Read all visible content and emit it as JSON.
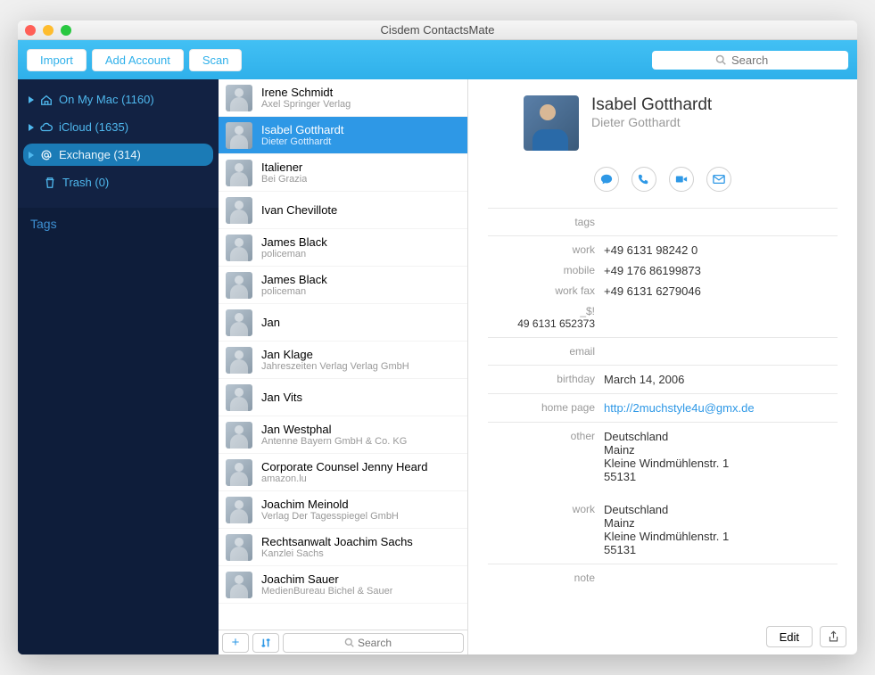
{
  "window": {
    "title": "Cisdem ContactsMate"
  },
  "toolbar": {
    "import": "Import",
    "add_account": "Add Account",
    "scan": "Scan",
    "search_placeholder": "Search"
  },
  "sidebar": {
    "accounts": [
      {
        "icon": "home",
        "label": "On My Mac (1160)",
        "selected": false
      },
      {
        "icon": "cloud",
        "label": "iCloud (1635)",
        "selected": false
      },
      {
        "icon": "at",
        "label": "Exchange (314)",
        "selected": true
      }
    ],
    "trash": "Trash (0)",
    "tags_label": "Tags"
  },
  "contacts": [
    {
      "name": "Irene Schmidt",
      "sub": "Axel Springer Verlag",
      "selected": false
    },
    {
      "name": "Isabel Gotthardt",
      "sub": "Dieter Gotthardt",
      "selected": true
    },
    {
      "name": "Italiener",
      "sub": "Bei Grazia",
      "selected": false
    },
    {
      "name": "Ivan Chevillote",
      "sub": "",
      "selected": false
    },
    {
      "name": "James Black",
      "sub": "policeman",
      "selected": false
    },
    {
      "name": "James Black",
      "sub": "policeman",
      "selected": false
    },
    {
      "name": "Jan",
      "sub": "",
      "selected": false
    },
    {
      "name": "Jan Klage",
      "sub": "Jahreszeiten Verlag Verlag GmbH",
      "selected": false
    },
    {
      "name": "Jan Vits",
      "sub": "",
      "selected": false
    },
    {
      "name": "Jan Westphal",
      "sub": "Antenne Bayern GmbH & Co. KG",
      "selected": false
    },
    {
      "name": "Corporate Counsel Jenny Heard",
      "sub": "amazon.lu",
      "selected": false
    },
    {
      "name": "Joachim Meinold",
      "sub": "Verlag Der Tagesspiegel GmbH",
      "selected": false
    },
    {
      "name": "Rechtsanwalt Joachim Sachs",
      "sub": "Kanzlei Sachs",
      "selected": false
    },
    {
      "name": "Joachim Sauer",
      "sub": "MedienBureau Bichel & Sauer",
      "selected": false
    }
  ],
  "bottom_search_placeholder": "Search",
  "detail": {
    "name": "Isabel Gotthardt",
    "subname": "Dieter Gotthardt",
    "section_tags": "tags",
    "phones": [
      {
        "label": "work",
        "value": "+49 6131 98242 0"
      },
      {
        "label": "mobile",
        "value": "+49 176 86199873"
      },
      {
        "label": "work fax",
        "value": "+49 6131 6279046"
      },
      {
        "label": "_$!<EX-CarPhone…",
        "value": "49 6131 652373"
      }
    ],
    "section_email": "email",
    "birthday_label": "birthday",
    "birthday": "March 14, 2006",
    "homepage_label": "home page",
    "homepage": "http://2muchstyle4u@gmx.de",
    "addresses": [
      {
        "label": "other",
        "lines": [
          "Deutschland",
          "Mainz",
          "Kleine Windmühlenstr. 1",
          "55131"
        ]
      },
      {
        "label": "work",
        "lines": [
          "Deutschland",
          "Mainz",
          "Kleine Windmühlenstr. 1",
          "55131"
        ]
      }
    ],
    "section_note": "note",
    "edit": "Edit"
  }
}
